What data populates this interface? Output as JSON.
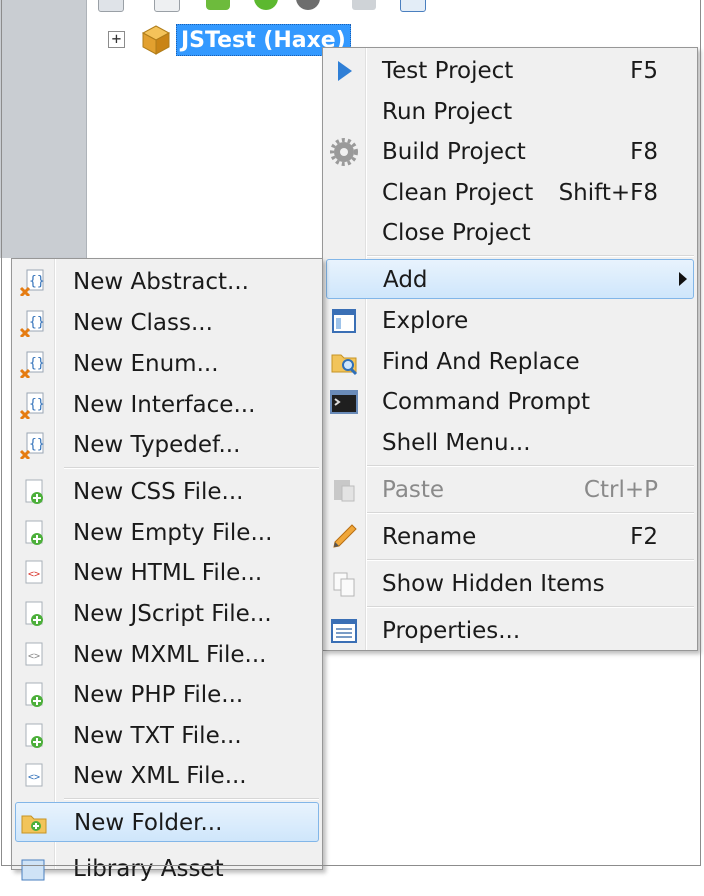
{
  "tree": {
    "expander": "+",
    "project_label": "JSTest (Haxe)"
  },
  "context_menu": {
    "items": [
      {
        "label": "Test Project",
        "shortcut": "F5",
        "icon": "play-arrow-icon"
      },
      {
        "label": "Run Project",
        "shortcut": "",
        "icon": ""
      },
      {
        "label": "Build Project",
        "shortcut": "F8",
        "icon": "gear-icon"
      },
      {
        "label": "Clean Project",
        "shortcut": "Shift+F8",
        "icon": ""
      },
      {
        "label": "Close Project",
        "shortcut": "",
        "icon": ""
      },
      {
        "label": "Add",
        "shortcut": "",
        "icon": "",
        "submenu": true
      },
      {
        "label": "Explore",
        "shortcut": "",
        "icon": "explorer-window-icon"
      },
      {
        "label": "Find And Replace",
        "shortcut": "",
        "icon": "folder-search-icon"
      },
      {
        "label": "Command Prompt",
        "shortcut": "",
        "icon": "terminal-icon"
      },
      {
        "label": "Shell Menu...",
        "shortcut": "",
        "icon": ""
      },
      {
        "label": "Paste",
        "shortcut": "Ctrl+P",
        "icon": "clipboard-icon",
        "disabled": true
      },
      {
        "label": "Rename",
        "shortcut": "F2",
        "icon": "pencil-icon"
      },
      {
        "label": "Show Hidden Items",
        "shortcut": "",
        "icon": "documents-icon"
      },
      {
        "label": "Properties...",
        "shortcut": "",
        "icon": "properties-list-icon"
      }
    ]
  },
  "add_submenu": {
    "items": [
      {
        "label": "New Abstract...",
        "icon": "haxe-class-new-icon"
      },
      {
        "label": "New Class...",
        "icon": "haxe-class-new-icon"
      },
      {
        "label": "New Enum...",
        "icon": "haxe-class-new-icon"
      },
      {
        "label": "New Interface...",
        "icon": "haxe-class-new-icon"
      },
      {
        "label": "New Typedef...",
        "icon": "haxe-class-new-icon"
      },
      {
        "label": "New CSS File...",
        "icon": "new-file-icon"
      },
      {
        "label": "New Empty File...",
        "icon": "new-file-icon"
      },
      {
        "label": "New HTML File...",
        "icon": "html-file-icon"
      },
      {
        "label": "New JScript File...",
        "icon": "new-file-icon"
      },
      {
        "label": "New MXML File...",
        "icon": "mxml-file-icon"
      },
      {
        "label": "New PHP File...",
        "icon": "new-file-icon"
      },
      {
        "label": "New TXT File...",
        "icon": "new-file-icon"
      },
      {
        "label": "New XML File...",
        "icon": "xml-file-icon"
      },
      {
        "label": "New Folder...",
        "icon": "new-folder-icon"
      },
      {
        "label": "Library Asset",
        "icon": "library-asset-icon"
      }
    ]
  },
  "colors": {
    "selection": "#3399ff",
    "menu_bg": "#f0f0f0",
    "highlight_border": "#82b6e8"
  }
}
